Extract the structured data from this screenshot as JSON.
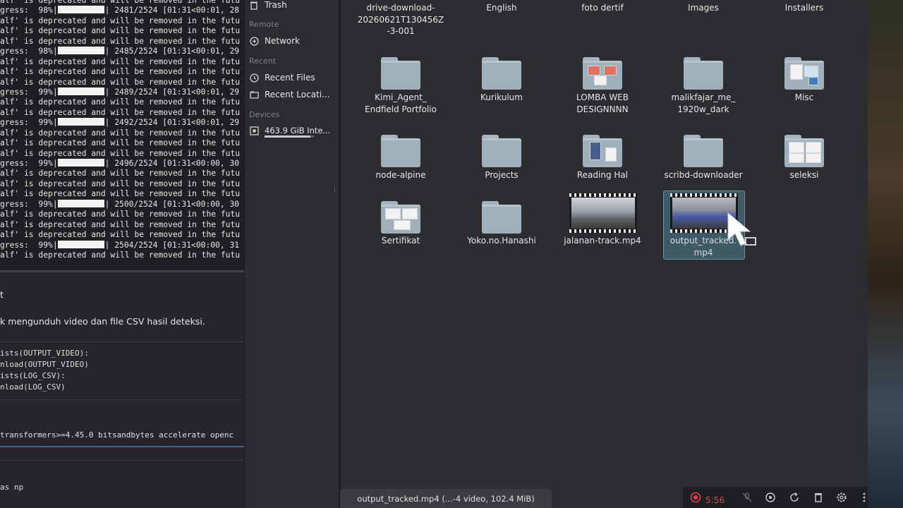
{
  "terminal": {
    "lines": [
      {
        "kind": "warn",
        "text": "alf' is deprecated and will be removed in the futu"
      },
      {
        "kind": "prog",
        "pre": "gress:  98%|",
        "post": "| 2481/2524 [01:31<00:01, 28"
      },
      {
        "kind": "warn",
        "text": "alf' is deprecated and will be removed in the futu"
      },
      {
        "kind": "warn",
        "text": "alf' is deprecated and will be removed in the futu"
      },
      {
        "kind": "warn",
        "text": "alf' is deprecated and will be removed in the futu"
      },
      {
        "kind": "prog",
        "pre": "gress:  98%|",
        "post": "| 2485/2524 [01:31<00:01, 29"
      },
      {
        "kind": "warn",
        "text": "alf' is deprecated and will be removed in the futu"
      },
      {
        "kind": "warn",
        "text": "alf' is deprecated and will be removed in the futu"
      },
      {
        "kind": "warn",
        "text": "alf' is deprecated and will be removed in the futu"
      },
      {
        "kind": "prog",
        "pre": "gress:  99%|",
        "post": "| 2489/2524 [01:31<00:01, 29"
      },
      {
        "kind": "warn",
        "text": "alf' is deprecated and will be removed in the futu"
      },
      {
        "kind": "warn",
        "text": "alf' is deprecated and will be removed in the futu"
      },
      {
        "kind": "prog",
        "pre": "gress:  99%|",
        "post": "| 2492/2524 [01:31<00:01, 29"
      },
      {
        "kind": "warn",
        "text": "alf' is deprecated and will be removed in the futu"
      },
      {
        "kind": "warn",
        "text": "alf' is deprecated and will be removed in the futu"
      },
      {
        "kind": "warn",
        "text": "alf' is deprecated and will be removed in the futu"
      },
      {
        "kind": "prog",
        "pre": "gress:  99%|",
        "post": "| 2496/2524 [01:31<00:00, 30"
      },
      {
        "kind": "warn",
        "text": "alf' is deprecated and will be removed in the futu"
      },
      {
        "kind": "warn",
        "text": "alf' is deprecated and will be removed in the futu"
      },
      {
        "kind": "warn",
        "text": "alf' is deprecated and will be removed in the futu"
      },
      {
        "kind": "prog",
        "pre": "gress:  99%|",
        "post": "| 2500/2524 [01:31<00:00, 30"
      },
      {
        "kind": "warn",
        "text": "alf' is deprecated and will be removed in the futu"
      },
      {
        "kind": "warn",
        "text": "alf' is deprecated and will be removed in the futu"
      },
      {
        "kind": "warn",
        "text": "alf' is deprecated and will be removed in the futu"
      },
      {
        "kind": "prog",
        "pre": "gress:  99%|",
        "post": "| 2504/2524 [01:31<00:00, 31"
      },
      {
        "kind": "warn",
        "text": "alf' is deprecated and will be removed in the futu"
      }
    ]
  },
  "notebook": {
    "cell_marker": "t",
    "markdown": "k mengunduh video dan file CSV hasil deteksi.",
    "code_lines": [
      "ists(OUTPUT_VIDEO):",
      "nload(OUTPUT_VIDEO)",
      "ists(LOG_CSV):",
      "nload(LOG_CSV)"
    ],
    "pip_line": "transformers>=4.45.0 bitsandbytes accelerate openc",
    "last_line": "as np"
  },
  "sidebar": {
    "trash": "Trash",
    "remote_header": "Remote",
    "network": "Network",
    "recent_header": "Recent",
    "recent_files": "Recent Files",
    "recent_locations": "Recent Locati...",
    "devices_header": "Devices",
    "drive": "463.9 GiB Inte...",
    "drive_usage_fraction": 0.93
  },
  "files": {
    "top_row": [
      "drive-download-\n20260621T130456Z\n-3-001",
      "English",
      "foto dertif",
      "Images",
      "Installers"
    ],
    "row2": [
      "Kimi_Agent_\nEndfield Portfolio",
      "Kurikulum",
      "LOMBA WEB\nDESIGNNNN",
      "malikfajar_me_\n1920w_dark",
      "Misc"
    ],
    "row3": [
      "node-alpine",
      "Projects",
      "Reading Hal",
      "scribd-downloader",
      "seleksi"
    ],
    "row4": [
      "Sertifikat",
      "Yoko.no.Hanashi",
      "jalanan-track.mp4",
      "output_tracked.\nmp4"
    ]
  },
  "status": {
    "text": "output_tracked.mp4 (...-4 video, 102.4 MiB)"
  },
  "recorder": {
    "time": "5:56",
    "record_color": "#e5434a"
  },
  "colors": {
    "folder": "#9fb0ba",
    "selection": "#3e5a66",
    "pane": "#2b2d31"
  },
  "icons": [
    "trash-icon",
    "network-icon",
    "recent-files-icon",
    "recent-locations-icon",
    "drive-icon",
    "record-icon",
    "mic-off-icon",
    "target-icon",
    "rotate-icon",
    "delete-icon",
    "settings-icon",
    "more-icon",
    "mouse-cursor-icon"
  ]
}
